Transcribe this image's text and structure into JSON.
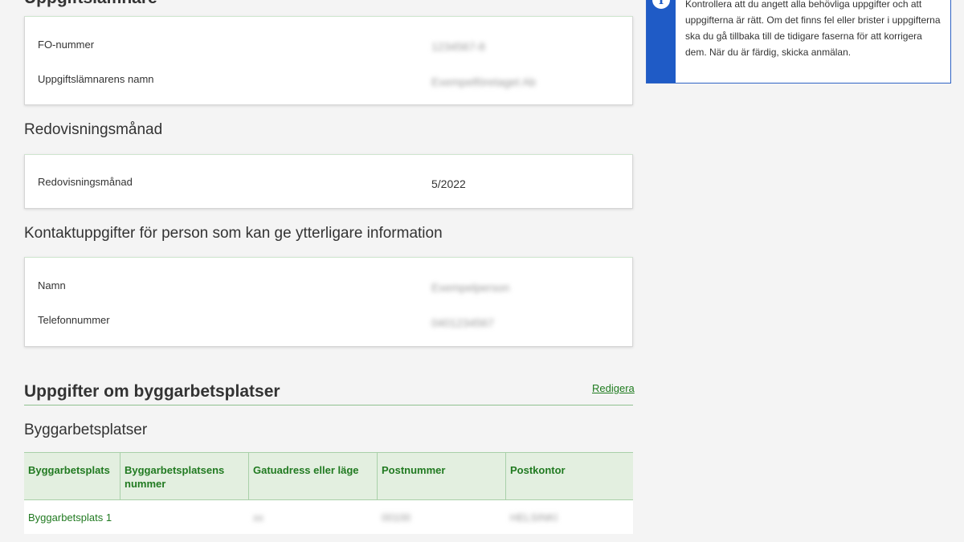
{
  "top_section": {
    "partial_heading": "Uppgiftslämnare",
    "rows": [
      {
        "label": "FO-nummer",
        "value": "1234567-8"
      },
      {
        "label": "Uppgiftslämnarens namn",
        "value": "Exempelföretaget Ab"
      }
    ]
  },
  "report_month": {
    "heading": "Redovisningsmånad",
    "row": {
      "label": "Redovisningsmånad",
      "value": "5/2022"
    }
  },
  "contact": {
    "heading": "Kontaktuppgifter för person som kan ge ytterligare information",
    "rows": [
      {
        "label": "Namn",
        "value": "Exempelperson"
      },
      {
        "label": "Telefonnummer",
        "value": "0401234567"
      }
    ]
  },
  "sites": {
    "title": "Uppgifter om byggarbetsplatser",
    "edit_label": "Redigera",
    "subheading": "Byggarbetsplatser",
    "columns": [
      "Byggarbetsplats",
      "Byggarbetsplatsens nummer",
      "Gatuadress eller läge",
      "Postnummer",
      "Postkontor"
    ],
    "rows": [
      {
        "site": "Byggarbetsplats 1",
        "number": "",
        "address": "xx",
        "postcode": "00100",
        "post_office": "HELSINKI"
      }
    ]
  },
  "info": {
    "icon": "info-icon",
    "text": "Kontrollera att du angett alla behövliga uppgifter och att uppgifterna är rätt. Om det finns fel eller brister i uppgifterna ska du gå tillbaka till de tidigare faserna för att korrigera dem. När du är färdig, skicka anmälan."
  },
  "colors": {
    "accent_green": "#217a21",
    "info_blue": "#1f5bc6",
    "table_header_bg": "#e3efe0"
  }
}
